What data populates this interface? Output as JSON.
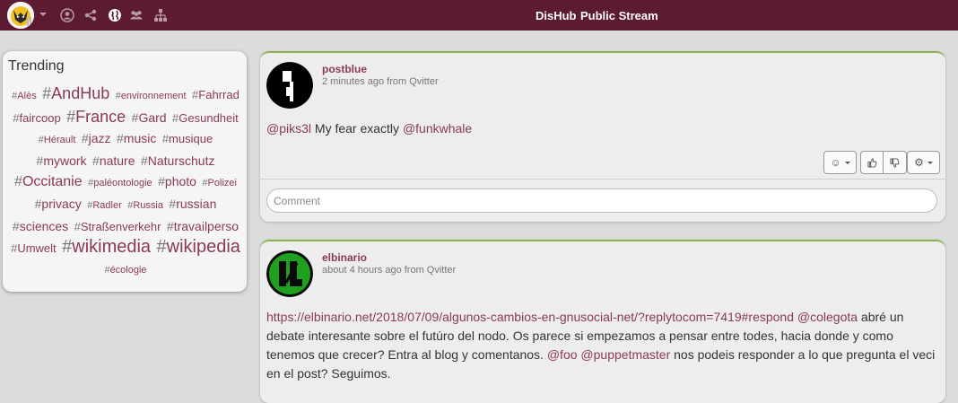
{
  "nav": {
    "brand": "DisHub",
    "stream_title": "Public Stream",
    "icons": [
      "user-icon",
      "network-icon",
      "globe-icon",
      "group-icon",
      "hierarchy-icon"
    ]
  },
  "trending": {
    "title": "Trending",
    "tags": [
      {
        "name": "Alès",
        "size": 1
      },
      {
        "name": "AndHub",
        "size": 5
      },
      {
        "name": "environnement",
        "size": 1
      },
      {
        "name": "Fahrrad",
        "size": 2
      },
      {
        "name": "faircoop",
        "size": 2
      },
      {
        "name": "France",
        "size": 5
      },
      {
        "name": "Gard",
        "size": 3
      },
      {
        "name": "Gesundheit",
        "size": 2
      },
      {
        "name": "Hérault",
        "size": 1
      },
      {
        "name": "jazz",
        "size": 3
      },
      {
        "name": "music",
        "size": 3
      },
      {
        "name": "musique",
        "size": 2
      },
      {
        "name": "mywork",
        "size": 3
      },
      {
        "name": "nature",
        "size": 3
      },
      {
        "name": "Naturschutz",
        "size": 3
      },
      {
        "name": "Occitanie",
        "size": 4
      },
      {
        "name": "paléontologie",
        "size": 1
      },
      {
        "name": "photo",
        "size": 3
      },
      {
        "name": "Polizei",
        "size": 1
      },
      {
        "name": "privacy",
        "size": 3
      },
      {
        "name": "Radler",
        "size": 1
      },
      {
        "name": "Russia",
        "size": 1
      },
      {
        "name": "russian",
        "size": 3
      },
      {
        "name": "sciences",
        "size": 3
      },
      {
        "name": "Straßenverkehr",
        "size": 2
      },
      {
        "name": "travailperso",
        "size": 3
      },
      {
        "name": "Umwelt",
        "size": 2
      },
      {
        "name": "wikimedia",
        "size": 6
      },
      {
        "name": "wikipedia",
        "size": 6
      },
      {
        "name": "écologie",
        "size": 1
      }
    ]
  },
  "posts": [
    {
      "author": "postblue",
      "meta": "2 minutes ago from Qvitter",
      "body": {
        "mention1": "@piks3l",
        "text1": " My fear exactly ",
        "mention2": "@funkwhale"
      },
      "comment_placeholder": "Comment"
    },
    {
      "author": "elbinario",
      "meta": "about 4 hours ago from Qvitter",
      "body": {
        "link": "https://elbinario.net/2018/07/09/algunos-cambios-en-gnusocial-net/?replytocom=7419#respond",
        "mention1": "@colegota",
        "text1": " abré un debate interesante sobre el futúro del nodo. Os parece si empezamos a pensar entre todes, hacia donde y como tenemos que crecer? Entra al blog y comentanos. ",
        "mention2": "@foo",
        "mention3": "@puppetmaster",
        "text2": " nos podeis responder a lo que pregunta el veci en el post? Seguimos."
      }
    }
  ]
}
